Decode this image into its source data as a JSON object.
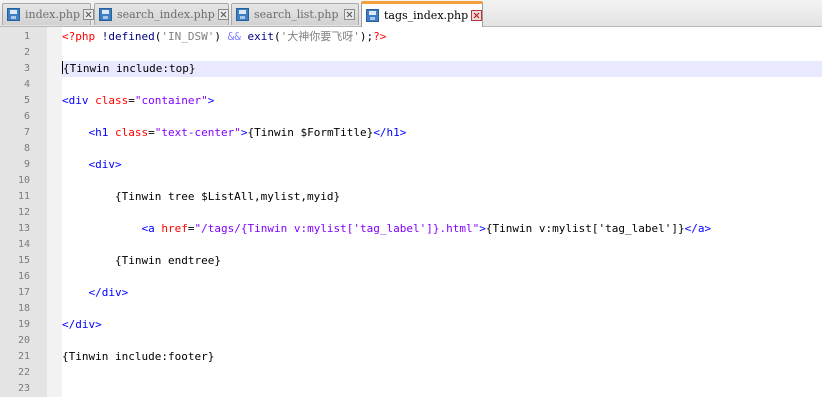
{
  "tabs": [
    {
      "label": "index.php",
      "active": false,
      "icon": "floppy-disk-icon"
    },
    {
      "label": "search_index.php",
      "active": false,
      "icon": "floppy-disk-icon"
    },
    {
      "label": "search_list.php",
      "active": false,
      "icon": "floppy-disk-icon"
    },
    {
      "label": "tags_index.php",
      "active": true,
      "icon": "floppy-disk-icon"
    }
  ],
  "colors": {
    "active_tab_accent": "#f4a03a",
    "current_line": "#e8e8ff",
    "php_tag": "#ff0000",
    "html_tag": "#0000ff",
    "html_attr": "#ff0000",
    "html_attr_value": "#8000ff"
  },
  "editor": {
    "current_line": 3,
    "lines": [
      {
        "n": "1",
        "tokens": [
          [
            "php",
            "<?php "
          ],
          [
            "fn",
            "!defined"
          ],
          [
            "tpl",
            "("
          ],
          [
            "str",
            "'IN_DSW'"
          ],
          [
            "tpl",
            ") "
          ],
          [
            "op",
            "&&"
          ],
          [
            "tpl",
            " "
          ],
          [
            "fn",
            "exit"
          ],
          [
            "tpl",
            "("
          ],
          [
            "str",
            "'大神你要飞呀'"
          ],
          [
            "tpl",
            ");"
          ],
          [
            "php",
            "?>"
          ]
        ]
      },
      {
        "n": "2",
        "tokens": []
      },
      {
        "n": "3",
        "tokens": [
          [
            "tpl",
            "{Tinwin include:top}"
          ]
        ]
      },
      {
        "n": "4",
        "tokens": []
      },
      {
        "n": "5",
        "tokens": [
          [
            "tag",
            "<div "
          ],
          [
            "attr",
            "class"
          ],
          [
            "tpl",
            "="
          ],
          [
            "val",
            "\"container\""
          ],
          [
            "tag",
            ">"
          ]
        ]
      },
      {
        "n": "6",
        "tokens": []
      },
      {
        "n": "7",
        "tokens": [
          [
            "tpl",
            "    "
          ],
          [
            "tag",
            "<h1 "
          ],
          [
            "attr",
            "class"
          ],
          [
            "tpl",
            "="
          ],
          [
            "val",
            "\"text-center\""
          ],
          [
            "tag",
            ">"
          ],
          [
            "tpl",
            "{Tinwin $FormTitle}"
          ],
          [
            "tag",
            "</h1>"
          ]
        ]
      },
      {
        "n": "8",
        "tokens": []
      },
      {
        "n": "9",
        "tokens": [
          [
            "tpl",
            "    "
          ],
          [
            "tag",
            "<div>"
          ]
        ]
      },
      {
        "n": "10",
        "tokens": []
      },
      {
        "n": "11",
        "tokens": [
          [
            "tpl",
            "        {Tinwin tree $ListAll,mylist,myid}"
          ]
        ]
      },
      {
        "n": "12",
        "tokens": []
      },
      {
        "n": "13",
        "tokens": [
          [
            "tpl",
            "            "
          ],
          [
            "tag",
            "<a "
          ],
          [
            "attr",
            "href"
          ],
          [
            "tpl",
            "="
          ],
          [
            "val",
            "\"/tags/{Tinwin v:mylist['tag_label']}.html\""
          ],
          [
            "tag",
            ">"
          ],
          [
            "tpl",
            "{Tinwin v:mylist['tag_label']}"
          ],
          [
            "tag",
            "</a>"
          ]
        ]
      },
      {
        "n": "14",
        "tokens": []
      },
      {
        "n": "15",
        "tokens": [
          [
            "tpl",
            "        {Tinwin endtree}"
          ]
        ]
      },
      {
        "n": "16",
        "tokens": []
      },
      {
        "n": "17",
        "tokens": [
          [
            "tpl",
            "    "
          ],
          [
            "tag",
            "</div>"
          ]
        ]
      },
      {
        "n": "18",
        "tokens": []
      },
      {
        "n": "19",
        "tokens": [
          [
            "tag",
            "</div>"
          ]
        ]
      },
      {
        "n": "20",
        "tokens": []
      },
      {
        "n": "21",
        "tokens": [
          [
            "tpl",
            "{Tinwin include:footer}"
          ]
        ]
      },
      {
        "n": "22",
        "tokens": []
      },
      {
        "n": "23",
        "tokens": []
      }
    ]
  }
}
